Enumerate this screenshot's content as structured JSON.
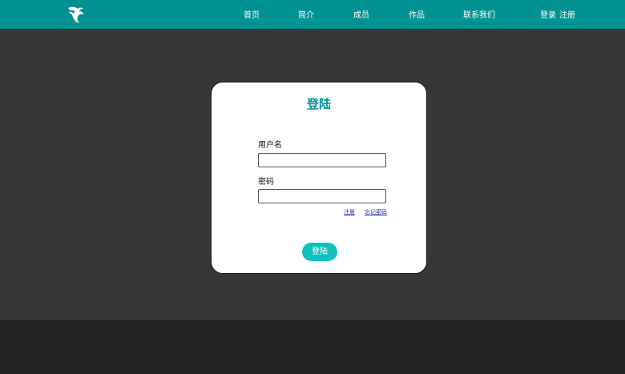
{
  "nav": {
    "logo_icon": "eagle-head-icon",
    "items": [
      {
        "label": "首页"
      },
      {
        "label": "简介"
      },
      {
        "label": "成员"
      },
      {
        "label": "作品"
      },
      {
        "label": "联系我们"
      }
    ],
    "login_label": "登录",
    "register_label": "注册"
  },
  "login_card": {
    "title": "登陆",
    "username_label": "用户名",
    "username_value": "",
    "password_label": "密码",
    "password_value": "",
    "register_link": "注册",
    "forgot_link": "忘记密码",
    "submit_label": "登陆"
  },
  "colors": {
    "accent": "#009392",
    "button": "#12c1bd",
    "main_bg": "#363636",
    "footer_bg": "#232323"
  }
}
